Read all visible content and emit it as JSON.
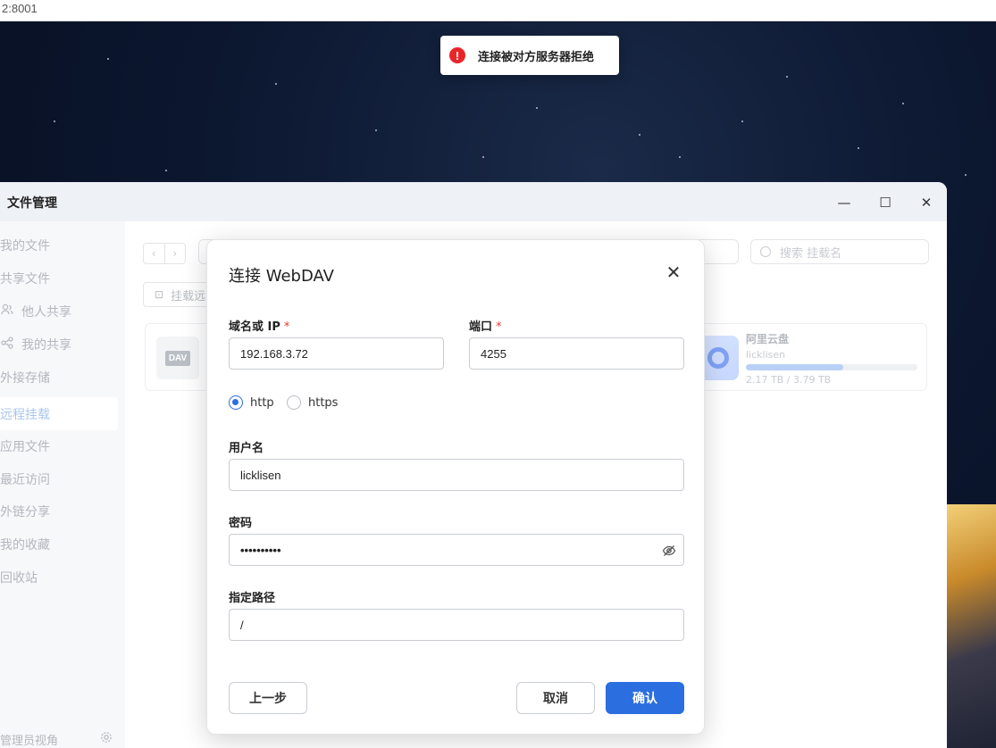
{
  "browser": {
    "address": "2:8001"
  },
  "toast": {
    "icon": "error-icon",
    "message": "连接被对方服务器拒绝",
    "color": "#e8262a"
  },
  "window": {
    "title": "文件管理",
    "controls": {
      "minimize": "—",
      "maximize": "☐",
      "close": "✕"
    }
  },
  "sidebar": {
    "items": [
      {
        "label": "我的文件",
        "icon": ""
      },
      {
        "label": "共享文件",
        "icon": ""
      },
      {
        "label": "他人共享",
        "icon": "users-icon"
      },
      {
        "label": "我的共享",
        "icon": "share-icon"
      },
      {
        "label": "外接存储",
        "icon": ""
      },
      {
        "label": "远程挂载",
        "icon": "",
        "active": true
      },
      {
        "label": "应用文件",
        "icon": ""
      },
      {
        "label": "最近访问",
        "icon": ""
      },
      {
        "label": "外链分享",
        "icon": ""
      },
      {
        "label": "我的收藏",
        "icon": ""
      },
      {
        "label": "回收站",
        "icon": ""
      }
    ],
    "footer": {
      "label": "管理员视角",
      "icon": "gear-icon"
    }
  },
  "main": {
    "search_placeholder": "搜索 挂载名",
    "mount_button": "挂载远",
    "cards": {
      "dav_badge": "DAV",
      "aliyun": {
        "name": "阿里云盘",
        "user": "licklisen",
        "usage": "2.17 TB / 3.79 TB",
        "usage_fraction": 0.57
      }
    }
  },
  "dialog": {
    "title": "连接 WebDAV",
    "host": {
      "label": "域名或 IP",
      "required": "*",
      "value": "192.168.3.72"
    },
    "port": {
      "label": "端口",
      "required": "*",
      "value": "4255"
    },
    "protocol": {
      "options": [
        "http",
        "https"
      ],
      "selected": "http"
    },
    "username": {
      "label": "用户名",
      "value": "licklisen"
    },
    "password": {
      "label": "密码",
      "value": "••••••••••"
    },
    "path": {
      "label": "指定路径",
      "value": "/"
    },
    "buttons": {
      "back": "上一步",
      "cancel": "取消",
      "confirm": "确认"
    },
    "accent": "#2a6ee0"
  }
}
